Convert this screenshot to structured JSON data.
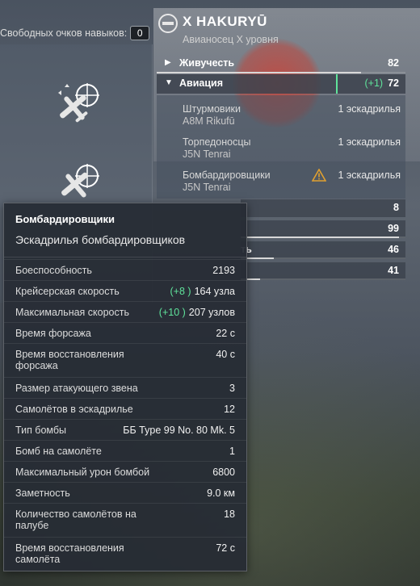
{
  "skills_panel": {
    "free_points_label": "Свободных очков навыков:",
    "free_points_value": "0"
  },
  "ship": {
    "name": "X HAKURYŪ",
    "subtitle": "Авианосец X уровня"
  },
  "stats": [
    {
      "label": "Живучесть",
      "value": "82",
      "expanded": false,
      "level": 0.82
    },
    {
      "label": "Авиация",
      "bonus": "+1",
      "value": "72",
      "expanded": true,
      "level": 0.72
    }
  ],
  "squadrons": [
    {
      "type": "Штурмовики",
      "plane": "A8M Rikufū",
      "count": "1 эскадрилья",
      "warning": false
    },
    {
      "type": "Торпедоносцы",
      "plane": "J5N Tenrai",
      "count": "1 эскадрилья",
      "warning": false
    },
    {
      "type": "Бомбардировщики",
      "plane": "J5N Tenrai",
      "count": "1 эскадрилья",
      "warning": true
    }
  ],
  "other_stats": [
    {
      "label": "",
      "value": "8"
    },
    {
      "label": "",
      "value": "99"
    },
    {
      "label": "ть",
      "value": "46"
    },
    {
      "label": "",
      "value": "41"
    }
  ],
  "tooltip": {
    "title": "Бомбардировщики",
    "subtitle": "Эскадрилья бомбардировщиков",
    "rows": [
      {
        "label": "Боеспособность",
        "bonus": "",
        "value": "2193"
      },
      {
        "label": "Крейсерская скорость",
        "bonus": "(+8  )",
        "value": "164 узла"
      },
      {
        "label": "Максимальная скорость",
        "bonus": "(+10  )",
        "value": "207 узлов"
      },
      {
        "label": "Время форсажа",
        "bonus": "",
        "value": "22 с"
      },
      {
        "label": "Время восстановления форсажа",
        "bonus": "",
        "value": "40 с"
      },
      {
        "label": "Размер атакующего звена",
        "bonus": "",
        "value": "3"
      },
      {
        "label": "Самолётов в эскадрилье",
        "bonus": "",
        "value": "12"
      },
      {
        "label": "Тип бомбы",
        "bonus": "",
        "value": "ББ Type 99 No. 80 Mk. 5"
      },
      {
        "label": "Бомб на самолёте",
        "bonus": "",
        "value": "1"
      },
      {
        "label": "Максимальный урон бомбой",
        "bonus": "",
        "value": "6800"
      },
      {
        "label": "Заметность",
        "bonus": "",
        "value": "9.0 км"
      },
      {
        "label": "Количество самолётов на палубе",
        "bonus": "",
        "value": "18"
      },
      {
        "label": "Время восстановления самолёта",
        "bonus": "",
        "value": "72 с"
      }
    ]
  }
}
